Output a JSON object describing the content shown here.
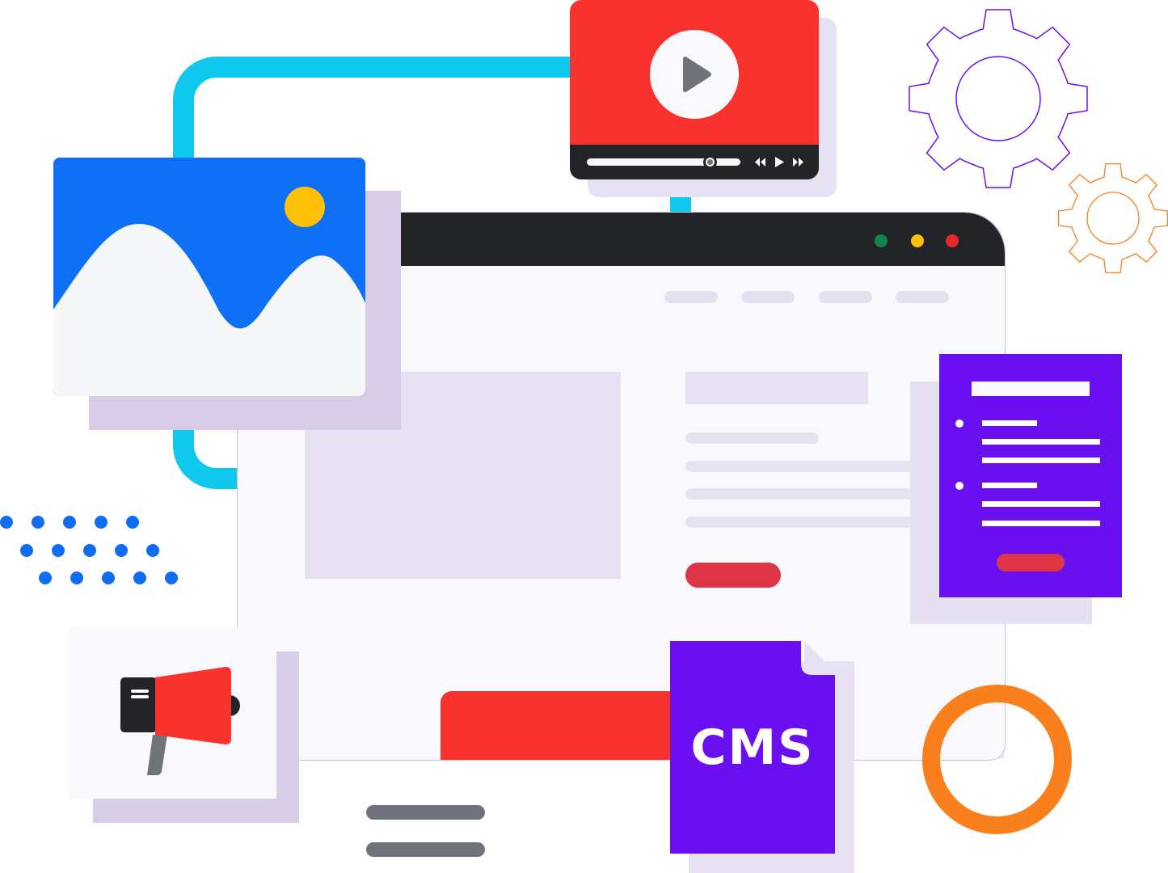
{
  "cms_label": "CMS",
  "colors": {
    "cyan": "#10c8ee",
    "blue": "#0e6ff7",
    "red": "#f8332e",
    "purple": "#6a0ff0",
    "orange": "#f9801d",
    "dark": "#232427",
    "gray": "#6f737a"
  },
  "browser": {
    "window_dots": [
      "#11874b",
      "#ffc106",
      "#e82727"
    ]
  },
  "video": {
    "progress": 0.8
  },
  "icons": [
    "play-icon",
    "rewind-icon",
    "forward-icon",
    "megaphone-icon",
    "gear-icon",
    "image-icon",
    "document-icon"
  ]
}
